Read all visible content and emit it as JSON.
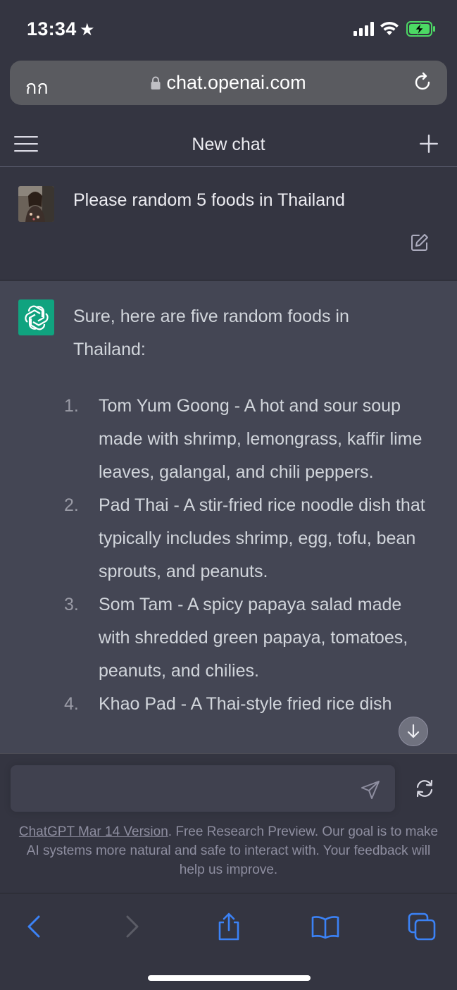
{
  "status_bar": {
    "time": "13:34",
    "star_icon": "star-icon",
    "battery_color": "#4cd964"
  },
  "url_bar": {
    "text_size_label": "กก",
    "url": "chat.openai.com",
    "lock_icon": "lock-icon",
    "reload_icon": "reload-icon"
  },
  "chat_header": {
    "title": "New chat",
    "menu_icon": "hamburger-menu-icon",
    "new_chat_icon": "plus-icon"
  },
  "user_message": {
    "text": "Please random 5 foods in Thailand",
    "edit_icon": "edit-icon"
  },
  "assistant_message": {
    "intro": "Sure, here are five random foods in Thailand:",
    "foods": [
      {
        "num": "1.",
        "text": "Tom Yum Goong - A hot and sour soup made with shrimp, lemongrass, kaffir lime leaves, galangal, and chili peppers."
      },
      {
        "num": "2.",
        "text": "Pad Thai - A stir-fried rice noodle dish that typically includes shrimp, egg, tofu, bean sprouts, and peanuts."
      },
      {
        "num": "3.",
        "text": "Som Tam - A spicy papaya salad made with shredded green papaya, tomatoes, peanuts, and chilies."
      },
      {
        "num": "4.",
        "text": "Khao Pad - A Thai-style fried rice dish"
      }
    ],
    "brand_color": "#10a37f"
  },
  "composer": {
    "placeholder": "",
    "send_icon": "send-icon",
    "regenerate_icon": "regenerate-icon"
  },
  "footer": {
    "link_text": "ChatGPT Mar 14 Version",
    "note": ". Free Research Preview. Our goal is to make AI systems more natural and safe to interact with. Your feedback will help us improve."
  },
  "toolbar": {
    "icons": [
      "back-icon",
      "forward-icon",
      "share-icon",
      "bookmarks-icon",
      "tabs-icon"
    ],
    "accent_color": "#3b82f6"
  }
}
